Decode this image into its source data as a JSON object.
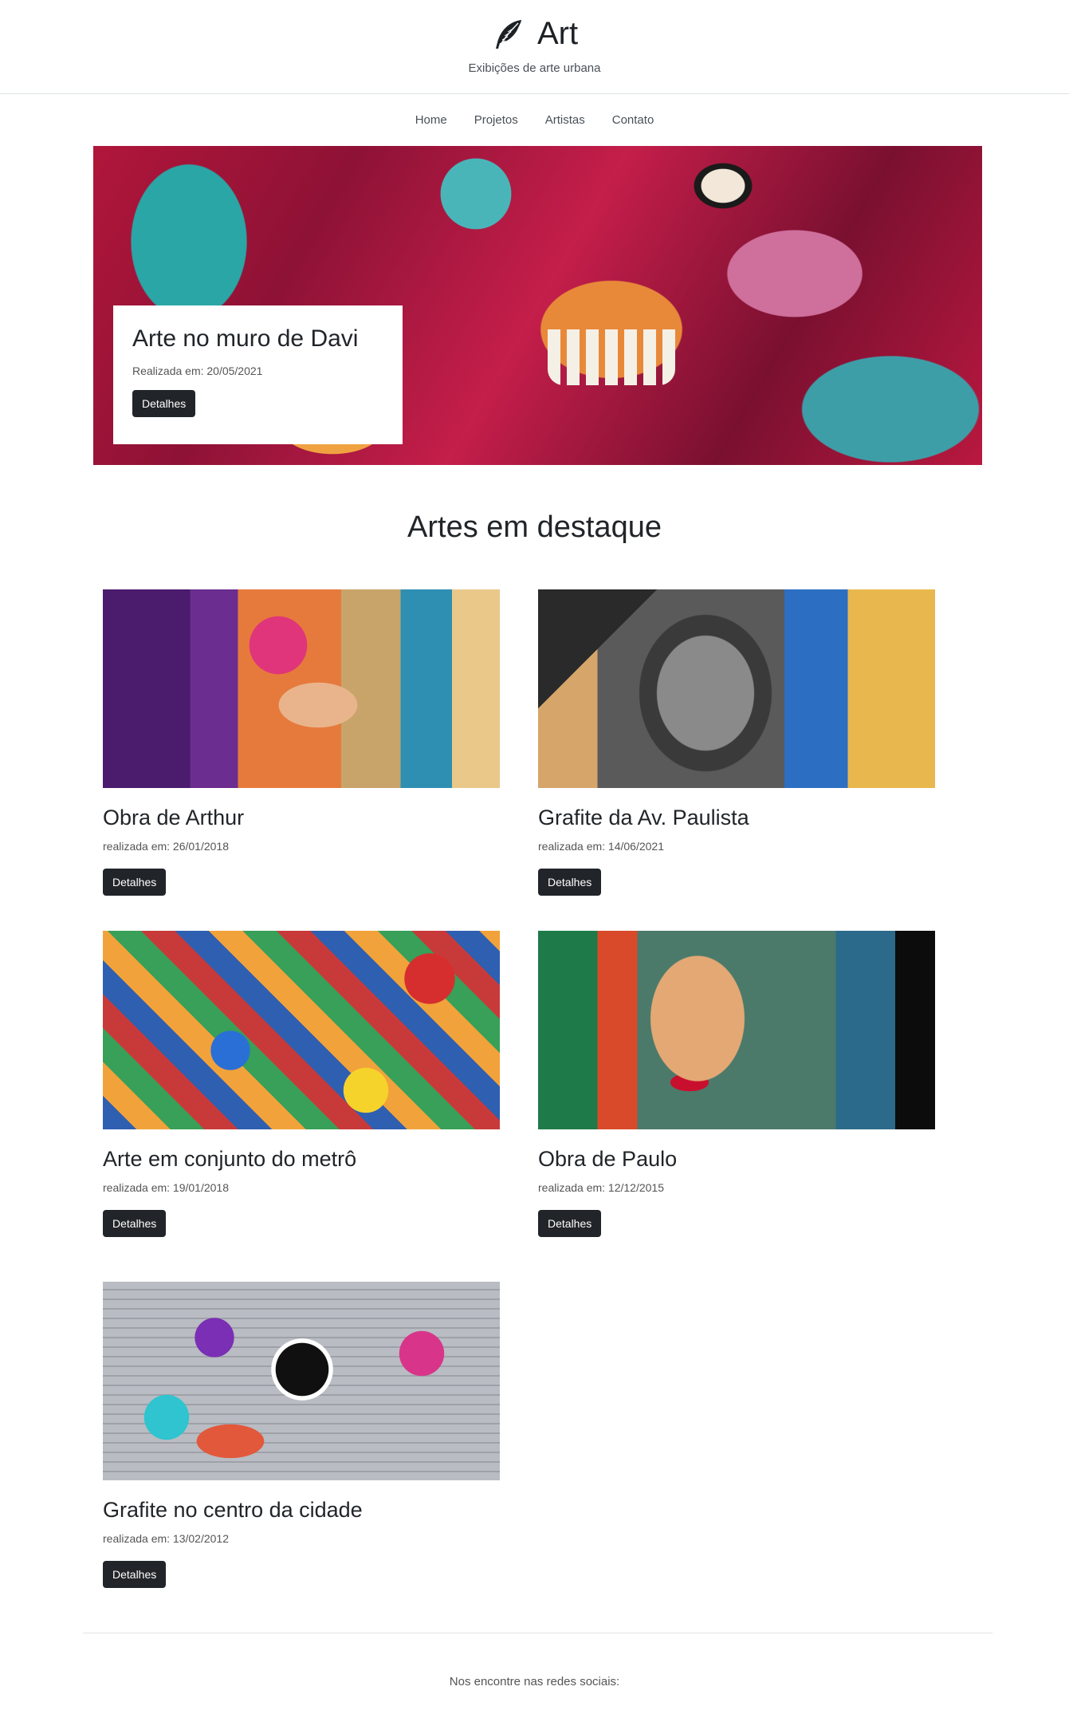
{
  "header": {
    "logo_icon": "feather-icon",
    "title": "Art",
    "tagline": "Exibições de arte urbana"
  },
  "nav": {
    "items": [
      {
        "label": "Home"
      },
      {
        "label": "Projetos"
      },
      {
        "label": "Artistas"
      },
      {
        "label": "Contato"
      }
    ]
  },
  "hero": {
    "title": "Arte no muro de Davi",
    "date": "Realizada em: 20/05/2021",
    "button_label": "Detalhes"
  },
  "featured": {
    "title": "Artes em destaque",
    "cards": [
      {
        "title": "Obra de Arthur",
        "date": "realizada em: 26/01/2018",
        "button_label": "Detalhes"
      },
      {
        "title": "Grafite da Av. Paulista",
        "date": "realizada em: 14/06/2021",
        "button_label": "Detalhes"
      },
      {
        "title": "Arte em conjunto do metrô",
        "date": "realizada em: 19/01/2018",
        "button_label": "Detalhes"
      },
      {
        "title": "Obra de Paulo",
        "date": "realizada em: 12/12/2015",
        "button_label": "Detalhes"
      },
      {
        "title": "Grafite no centro da cidade",
        "date": "realizada em: 13/02/2012",
        "button_label": "Detalhes"
      }
    ]
  },
  "footer": {
    "text": "Nos encontre nas redes sociais:"
  },
  "colors": {
    "button_bg": "#212529",
    "text": "#212529",
    "muted": "#555555",
    "border": "#dee2e6"
  }
}
